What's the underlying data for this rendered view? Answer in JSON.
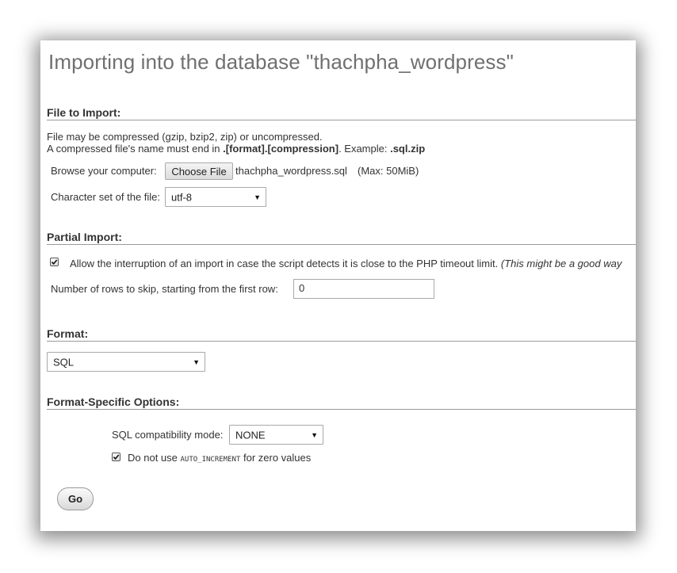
{
  "page": {
    "title": "Importing into the database \"thachpha_wordpress\""
  },
  "file_to_import": {
    "heading": "File to Import:",
    "line1": "File may be compressed (gzip, bzip2, zip) or uncompressed.",
    "line2_prefix": "A compressed file's name must end in ",
    "line2_bold": ".[format].[compression]",
    "line2_mid": ". Example: ",
    "line2_example": ".sql.zip",
    "browse_label": "Browse your computer:",
    "choose_file_label": "Choose File",
    "file_name": "thachpha_wordpress.sql",
    "max_size": "(Max: 50MiB)",
    "charset_label": "Character set of the file:",
    "charset_value": "utf-8"
  },
  "partial_import": {
    "heading": "Partial Import:",
    "allow_interrupt_checked": true,
    "allow_interrupt_label": "Allow the interruption of an import in case the script detects it is close to the PHP timeout limit.",
    "allow_interrupt_note": "(This might be a good way",
    "skip_rows_label": "Number of rows to skip, starting from the first row:",
    "skip_rows_value": "0"
  },
  "format": {
    "heading": "Format:",
    "value": "SQL"
  },
  "format_options": {
    "heading": "Format-Specific Options:",
    "compat_label": "SQL compatibility mode:",
    "compat_value": "NONE",
    "auto_inc_checked": true,
    "auto_inc_prefix": "Do not use ",
    "auto_inc_code": "AUTO_INCREMENT",
    "auto_inc_suffix": " for zero values"
  },
  "actions": {
    "go_label": "Go"
  },
  "icons": {
    "dropdown": "chevron-down-icon",
    "check": "checkmark-icon"
  }
}
